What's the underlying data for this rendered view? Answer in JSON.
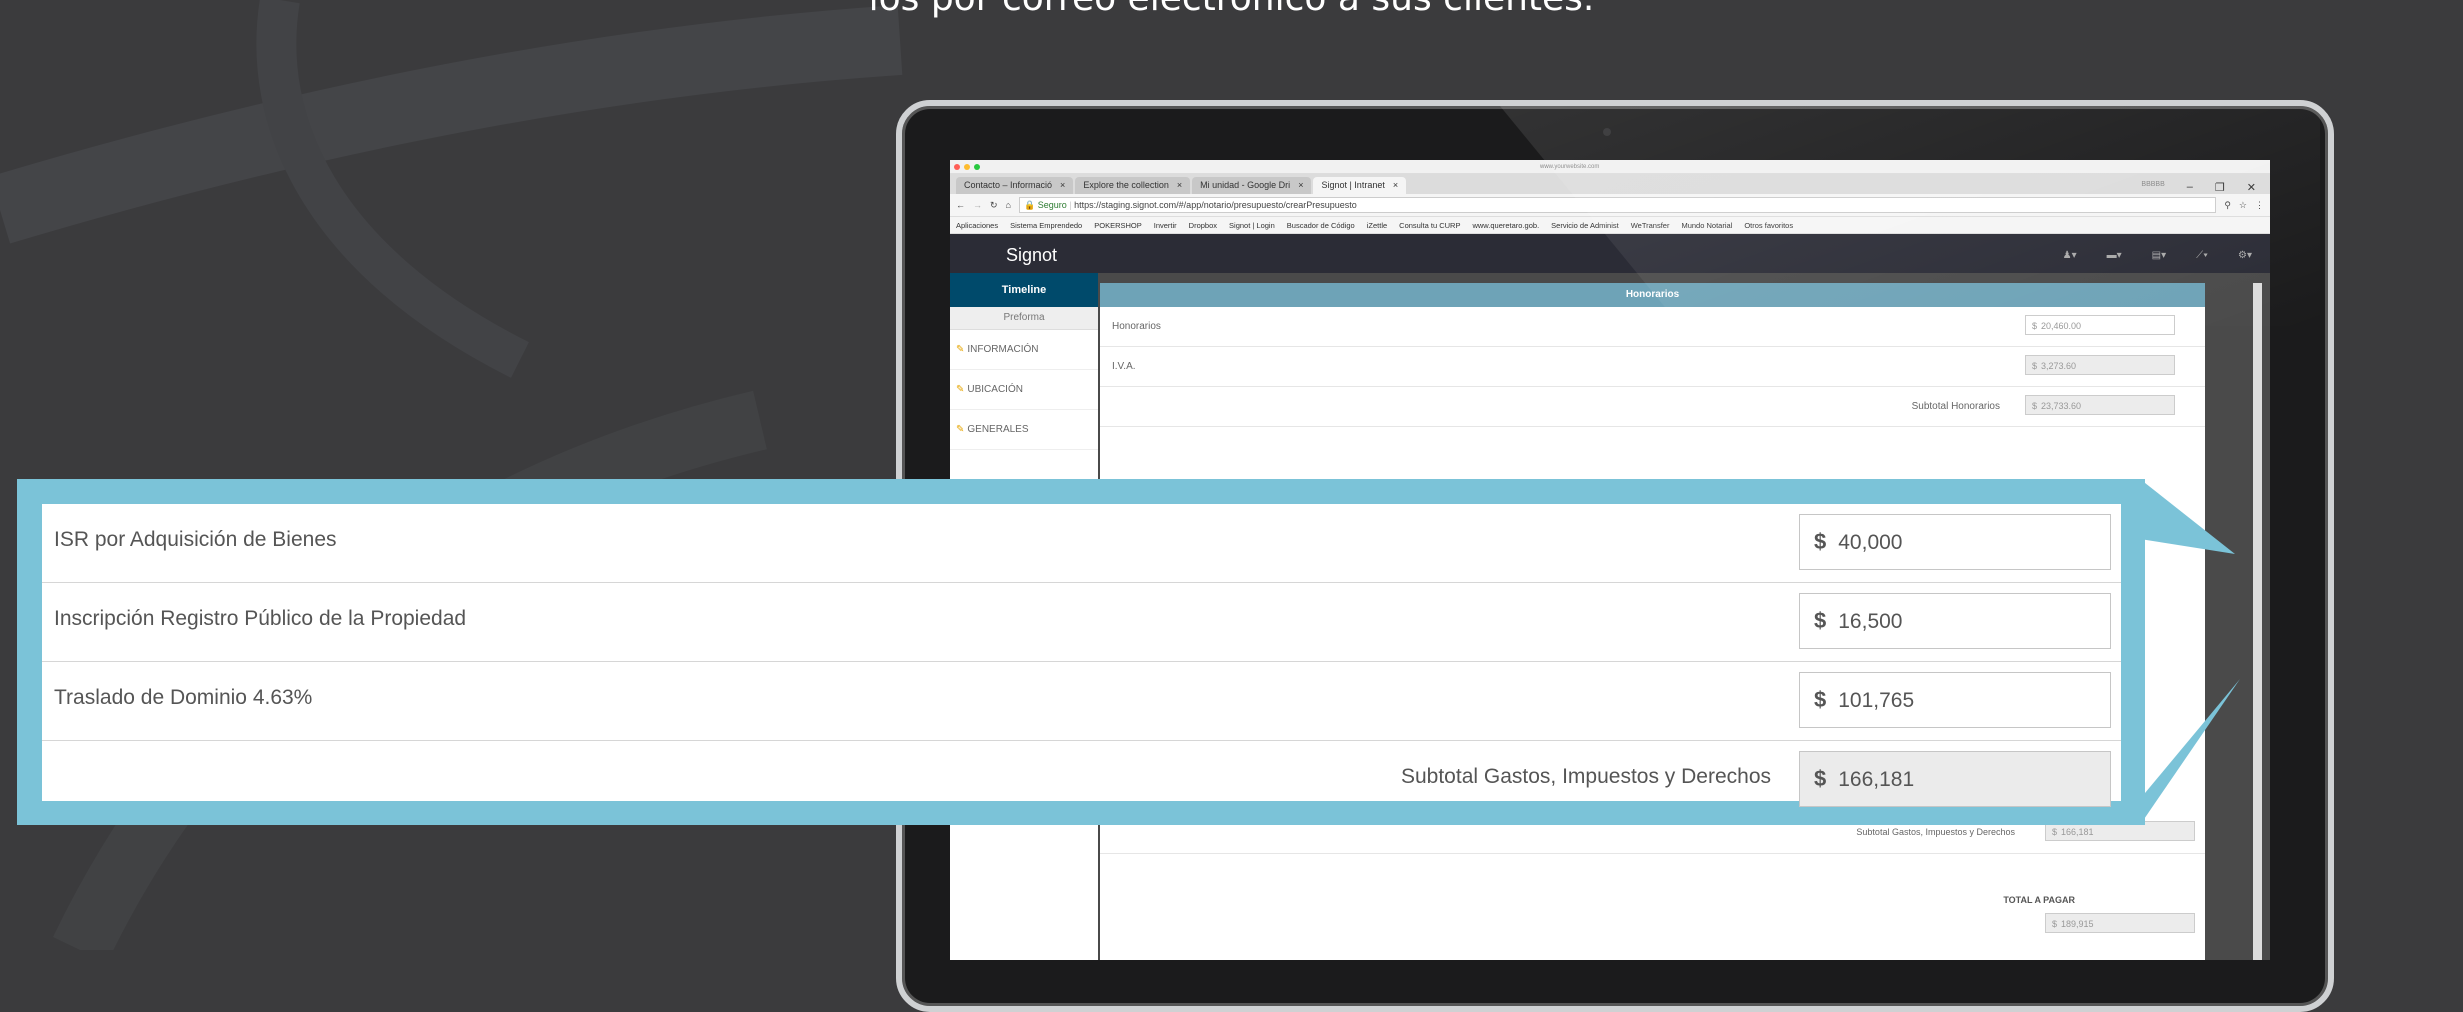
{
  "headline": "los por correo electrónico a sus clientes.",
  "browser": {
    "os_bar_text": "www.yourwebsite.com",
    "tabs": [
      {
        "label": "Contacto – Informació",
        "active": false
      },
      {
        "label": "Explore the collection",
        "active": false
      },
      {
        "label": "Mi unidad - Google Dri",
        "active": false
      },
      {
        "label": "Signot | Intranet",
        "active": true
      }
    ],
    "user_badge": "BBBBB",
    "secure_label": "Seguro",
    "url": "https://staging.signot.com/#/app/notario/presupuesto/crearPresupuesto",
    "bookmarks": [
      "Aplicaciones",
      "Sistema Emprendedo",
      "POKERSHOP",
      "Invertir",
      "Dropbox",
      "Signot | Login",
      "Buscador de Código",
      "iZettle",
      "Consulta tu CURP",
      "www.queretaro.gob.",
      "Servicio de Administ",
      "WeTransfer",
      "Mundo Notarial",
      "Otros favoritos"
    ]
  },
  "app": {
    "brand": "Signot",
    "sidebar": {
      "header": "Timeline",
      "sub": "Preforma",
      "items": [
        "INFORMACIÓN",
        "UBICACIÓN",
        "GENERALES"
      ]
    },
    "panel": {
      "title": "Honorarios",
      "rows": [
        {
          "label": "Honorarios",
          "currency": "$",
          "value": "20,460.00"
        },
        {
          "label": "I.V.A.",
          "currency": "$",
          "value": "3,273.60"
        }
      ],
      "subtotal": {
        "label": "Subtotal Honorarios",
        "currency": "$",
        "value": "23,733.60"
      },
      "gastos_subtotal": {
        "label": "Subtotal Gastos, Impuestos y Derechos",
        "currency": "$",
        "value": "166,181"
      },
      "total": {
        "label": "TOTAL A PAGAR",
        "currency": "$",
        "value": "189,915"
      }
    }
  },
  "callout": {
    "rows": [
      {
        "label": "ISR por Adquisición de Bienes",
        "currency": "$",
        "value": "40,000"
      },
      {
        "label": "Inscripción Registro Público de la Propiedad",
        "currency": "$",
        "value": "16,500"
      },
      {
        "label": "Traslado de Dominio 4.63%",
        "currency": "$",
        "value": "101,765"
      }
    ],
    "subtotal": {
      "label": "Subtotal Gastos, Impuestos y Derechos",
      "currency": "$",
      "value": "166,181"
    }
  },
  "colors": {
    "background": "#3b3b3d",
    "callout_accent": "#7bc3d8",
    "app_header": "#004a6b",
    "panel_header": "#6ea3b7"
  }
}
